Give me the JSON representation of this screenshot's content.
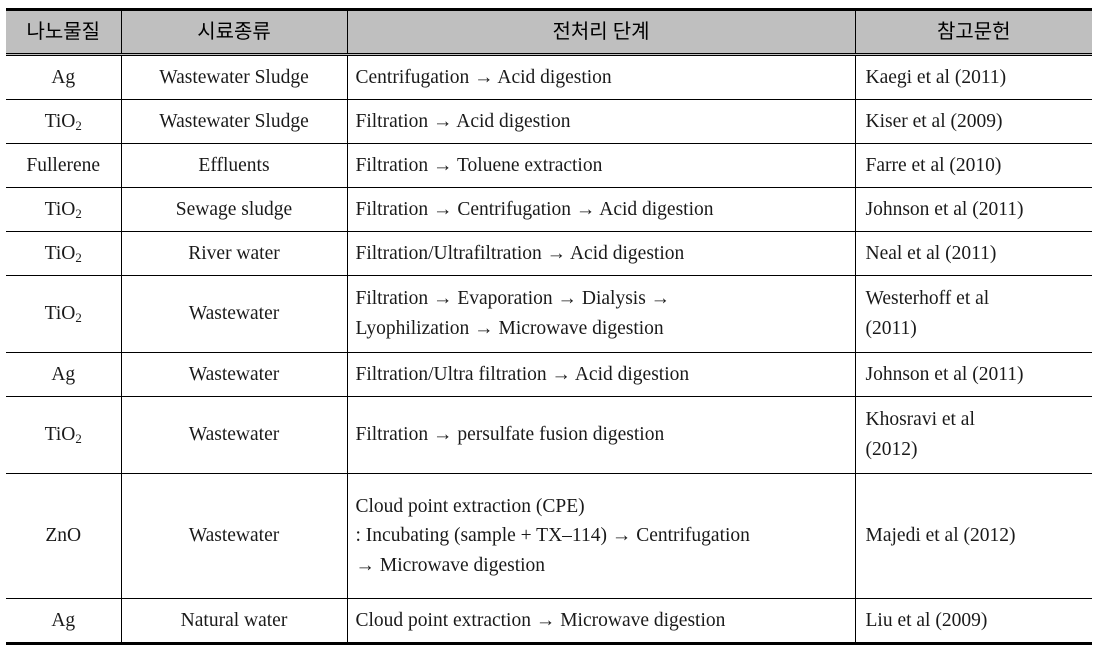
{
  "table": {
    "headers": [
      {
        "key": "material",
        "label": "나노물질"
      },
      {
        "key": "sample",
        "label": "시료종류"
      },
      {
        "key": "steps",
        "label": "전처리 단계"
      },
      {
        "key": "reference",
        "label": "참고문헌"
      }
    ],
    "rows": [
      {
        "material": "Ag",
        "material_sub": "",
        "sample": "Wastewater Sludge",
        "steps": [
          "Centrifugation → Acid digestion"
        ],
        "reference": [
          "Kaegi et al (2011)"
        ],
        "height": "norm"
      },
      {
        "material": "TiO",
        "material_sub": "2",
        "sample": "Wastewater Sludge",
        "steps": [
          "Filtration → Acid digestion"
        ],
        "reference": [
          "Kiser et al (2009)"
        ],
        "height": "norm"
      },
      {
        "material": "Fullerene",
        "material_sub": "",
        "sample": "Effluents",
        "steps": [
          "Filtration → Toluene extraction"
        ],
        "reference": [
          "Farre et al (2010)"
        ],
        "height": "norm"
      },
      {
        "material": "TiO",
        "material_sub": "2",
        "sample": "Sewage sludge",
        "steps": [
          "Filtration → Centrifugation → Acid digestion"
        ],
        "reference": [
          "Johnson et al (2011)"
        ],
        "height": "norm"
      },
      {
        "material": "TiO",
        "material_sub": "2",
        "sample": "River water",
        "steps": [
          "Filtration/Ultrafiltration → Acid digestion"
        ],
        "reference": [
          "Neal et al (2011)"
        ],
        "height": "norm"
      },
      {
        "material": "TiO",
        "material_sub": "2",
        "sample": "Wastewater",
        "steps": [
          "Filtration → Evaporation → Dialysis →",
          "Lyophilization → Microwave  digestion"
        ],
        "reference": [
          "Westerhoff et al",
          "(2011)"
        ],
        "height": "tall"
      },
      {
        "material": "Ag",
        "material_sub": "",
        "sample": "Wastewater",
        "steps": [
          "Filtration/Ultra filtration → Acid digestion"
        ],
        "reference": [
          "Johnson et al (2011)"
        ],
        "height": "norm"
      },
      {
        "material": "TiO",
        "material_sub": "2",
        "sample": "Wastewater",
        "steps": [
          "Filtration → persulfate fusion  digestion"
        ],
        "reference": [
          "Khosravi et al",
          "(2012)"
        ],
        "height": "tall"
      },
      {
        "material": "ZnO",
        "material_sub": "",
        "sample": "Wastewater",
        "steps": [
          "Cloud point extraction (CPE)",
          ": Incubating (sample + TX–114) → Centrifugation",
          "→ Microwave  digestion"
        ],
        "reference": [
          "Majedi et al (2012)"
        ],
        "height": "xtall"
      },
      {
        "material": "Ag",
        "material_sub": "",
        "sample": "Natural water",
        "steps": [
          "Cloud point extraction → Microwave  digestion"
        ],
        "reference": [
          "Liu et al (2009)"
        ],
        "height": "norm"
      }
    ]
  },
  "style": {
    "header_background": "#bfbfbf",
    "border_color": "#000000",
    "text_color": "#1a1a1a",
    "page_background": "#ffffff"
  }
}
